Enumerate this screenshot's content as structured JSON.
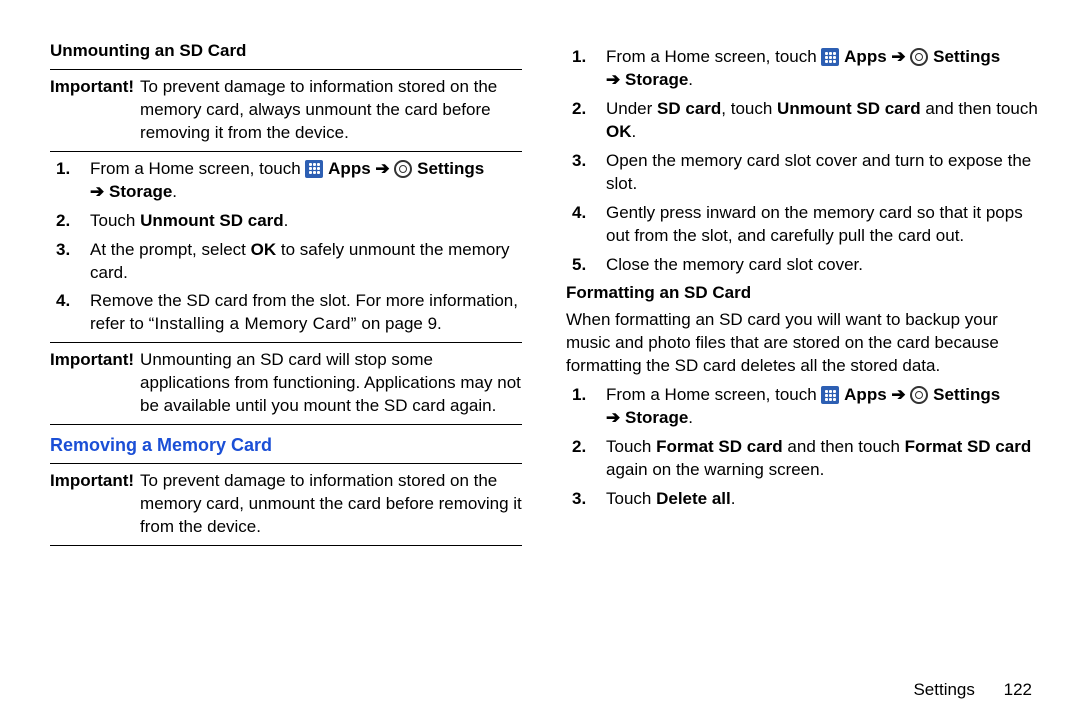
{
  "left": {
    "head_unmount": "Unmounting an SD Card",
    "important1_label": "Important!",
    "important1_text": "To prevent damage to information stored on the memory card, always unmount the card before removing it from the device.",
    "step1_pre": "From a Home screen, touch ",
    "apps_label": "Apps",
    "arrow": "➔",
    "settings_label": "Settings",
    "storage_label": "Storage",
    "period": ".",
    "step2_pre": "Touch ",
    "step2_bold": "Unmount SD card",
    "step3_pre": "At the prompt, select ",
    "ok_bold": "OK",
    "step3_post": " to safely unmount the memory card.",
    "step4_pre": "Remove the SD card from the slot. For more information, refer to ",
    "step4_quote": "“Installing a Memory Card”",
    "step4_post": " on page 9.",
    "important2_label": "Important!",
    "important2_text": "Unmounting an SD card will stop some applications from functioning. Applications may not be available until you mount the SD card again.",
    "head_remove": "Removing a Memory Card",
    "important3_label": "Important!",
    "important3_text": "To prevent damage to information stored on the memory card, unmount the card before removing it from the device."
  },
  "right": {
    "r1_pre": "From a Home screen, touch ",
    "apps_label": "Apps",
    "arrow": "➔",
    "settings_label": "Settings",
    "storage_label": "Storage",
    "period": ".",
    "r2_pre": "Under ",
    "r2_b1": "SD card",
    "r2_mid": ", touch ",
    "r2_b2": "Unmount SD card",
    "r2_post": " and then touch ",
    "r2_b3": "OK",
    "r3": "Open the memory card slot cover and turn to expose the slot.",
    "r4": "Gently press inward on the memory card so that it pops out from the slot, and carefully pull the card out.",
    "r5": "Close the memory card slot cover.",
    "head_format": "Formatting an SD Card",
    "format_intro": "When formatting an SD card you will want to backup your music and photo files that are stored on the card because formatting the SD card deletes all the stored data.",
    "f1_pre": "From a Home screen, touch ",
    "f2_pre": "Touch ",
    "f2_b1": "Format SD card",
    "f2_mid": " and then touch ",
    "f2_b2": "Format SD card",
    "f2_post": " again on the warning screen.",
    "f3_pre": "Touch ",
    "f3_b": "Delete all"
  },
  "footer": {
    "section": "Settings",
    "page": "122"
  }
}
